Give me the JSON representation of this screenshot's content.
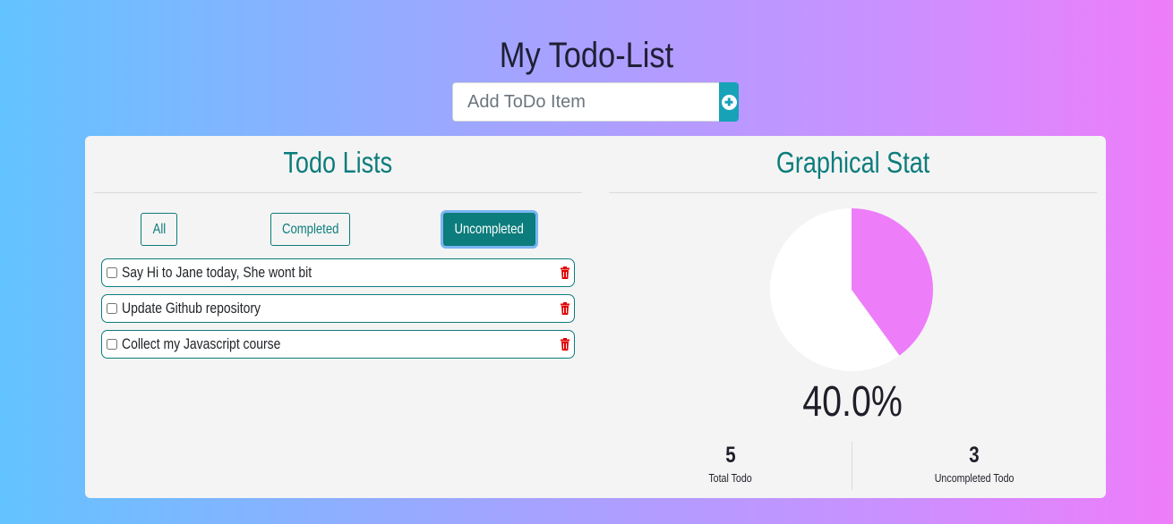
{
  "header": {
    "title": "My Todo-List",
    "add_placeholder": "Add ToDo Item",
    "add_button_icon": "plus-circle-icon"
  },
  "todo_panel": {
    "heading": "Todo Lists",
    "filters": [
      {
        "label": "All",
        "active": false
      },
      {
        "label": "Completed",
        "active": false
      },
      {
        "label": "Uncompleted",
        "active": true
      }
    ],
    "items": [
      {
        "text": "Say Hi to Jane today, She wont bit",
        "checked": false
      },
      {
        "text": "Update Github repository",
        "checked": false
      },
      {
        "text": "Collect my Javascript course",
        "checked": false
      }
    ],
    "delete_icon": "trash-icon"
  },
  "stat_panel": {
    "heading": "Graphical Stat",
    "percent_label": "40.0%",
    "total": {
      "value": "5",
      "label": "Total Todo"
    },
    "uncompleted": {
      "value": "3",
      "label": "Uncompleted Todo"
    }
  },
  "chart_data": {
    "type": "pie",
    "categories": [
      "Completed",
      "Uncompleted"
    ],
    "values": [
      2,
      3
    ],
    "colors": [
      "#ee7dfa",
      "#ffffff"
    ]
  },
  "colors": {
    "accent": "#0d7c7c",
    "add_button": "#17a2b8",
    "delete": "#e00000",
    "pie_completed": "#ee7dfa",
    "pie_remaining": "#ffffff"
  }
}
